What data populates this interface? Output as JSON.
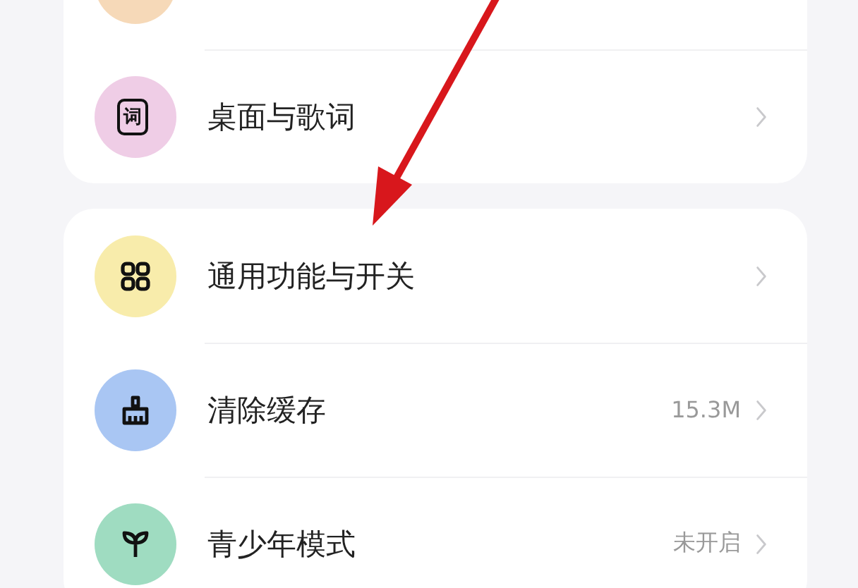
{
  "groups": [
    {
      "items": [
        {
          "kind": "cut",
          "color": "#f6d9b8"
        },
        {
          "kind": "lyrics",
          "glyph": "词",
          "color": "#efcde6",
          "label": "桌面与歌词"
        }
      ]
    },
    {
      "items": [
        {
          "kind": "grid",
          "color": "#f8ecab",
          "label": "通用功能与开关"
        },
        {
          "kind": "broom",
          "color": "#a9c6f3",
          "label": "清除缓存",
          "value": "15.3M"
        },
        {
          "kind": "sprout",
          "color": "#9fdcc1",
          "label": "青少年模式",
          "value": "未开启"
        }
      ]
    }
  ]
}
